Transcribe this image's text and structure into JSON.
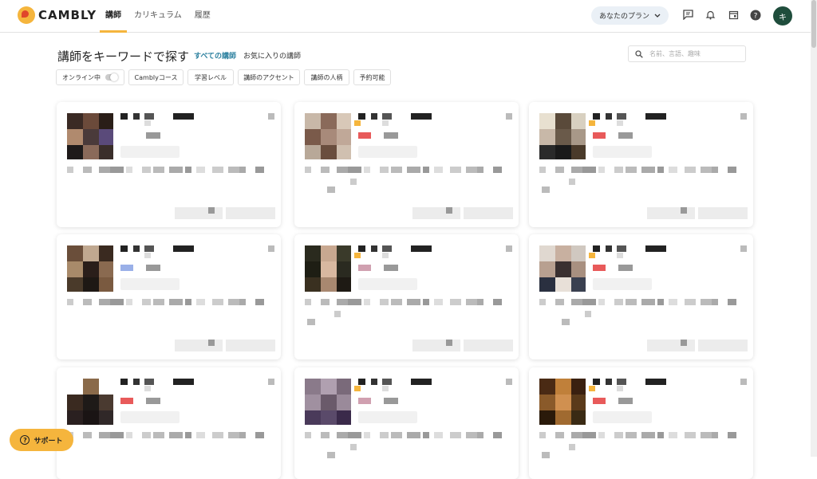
{
  "logo": "CAMBLY",
  "nav": {
    "items": [
      "講師",
      "カリキュラム",
      "履歴"
    ]
  },
  "header": {
    "plan_label": "あなたのプラン",
    "avatar_initial": "キ"
  },
  "search": {
    "title": "講師をキーワードで探す",
    "tab_all": "すべての講師",
    "tab_favorites": "お気に入りの講師",
    "placeholder": "名前、言語、趣味"
  },
  "filters": [
    "オンライン中",
    "Camblyコース",
    "学習レベル",
    "講師のアクセント",
    "講師の人柄",
    "予約可能"
  ],
  "support_label": "サポート",
  "colors": {
    "accent": "#f5b53d",
    "avatar_bg": "#1f4d3c",
    "link": "#2a7f9e"
  },
  "cards": [
    {
      "photo": [
        "#3a2a24",
        "#6b4a3a",
        "#2a1e18",
        "#b08a6e",
        "#4a3a3a",
        "#5a4a7a",
        "#1e1a1a",
        "#8a6a5a",
        "#3a2e2a"
      ],
      "badge": ""
    },
    {
      "photo": [
        "#c8b8a8",
        "#8a6a5a",
        "#d8c8b8",
        "#7a5a4a",
        "#a88a7a",
        "#c0a898",
        "#b8a898",
        "#6a4e3e",
        "#d0c0b0"
      ],
      "badge": "#e85a5a"
    },
    {
      "photo": [
        "#e8e0d0",
        "#5a4a3a",
        "#d8d0c0",
        "#c8b8a8",
        "#6a5a4a",
        "#a89888",
        "#2a2a2a",
        "#1a1a1a",
        "#4a3a2a"
      ],
      "badge": "#e85a5a"
    },
    {
      "photo": [
        "#6a4e3a",
        "#c0a890",
        "#3a2a20",
        "#a88a6a",
        "#2a1e1a",
        "#8a6a50",
        "#4a3a2a",
        "#1e1814",
        "#7a5a40"
      ],
      "badge": "#9ab0e8"
    },
    {
      "photo": [
        "#2a2a1e",
        "#c8a890",
        "#3a3a2a",
        "#1e1e14",
        "#d8b8a0",
        "#2a2a20",
        "#3a3020",
        "#a88870",
        "#1e1a14"
      ],
      "badge": "#d0a0b0"
    },
    {
      "photo": [
        "#e0d8d0",
        "#c8b0a0",
        "#d0c8c0",
        "#b8a090",
        "#3a3030",
        "#a89080",
        "#2a3040",
        "#e8e0d8",
        "#3a4050"
      ],
      "badge": "#e85a5a"
    },
    {
      "photo": [
        "#ffffff",
        "#8a6a4a",
        "#ffffff",
        "#3a2a20",
        "#1e1a18",
        "#4a3a30",
        "#2a2020",
        "#1a1414",
        "#302828"
      ],
      "badge": "#e85a5a"
    },
    {
      "photo": [
        "#8a7a8a",
        "#b0a0b0",
        "#7a6a7a",
        "#a090a0",
        "#6a5a6a",
        "#9a8a9a",
        "#4a3a5a",
        "#5a4a6a",
        "#3a2a4a"
      ],
      "badge": "#d0a0b0"
    },
    {
      "photo": [
        "#4a2a14",
        "#c0803a",
        "#3a2010",
        "#8a5a2a",
        "#d09050",
        "#5a3a1a",
        "#2a1a0a",
        "#a06a30",
        "#3a2a14"
      ],
      "badge": "#e85a5a"
    }
  ]
}
